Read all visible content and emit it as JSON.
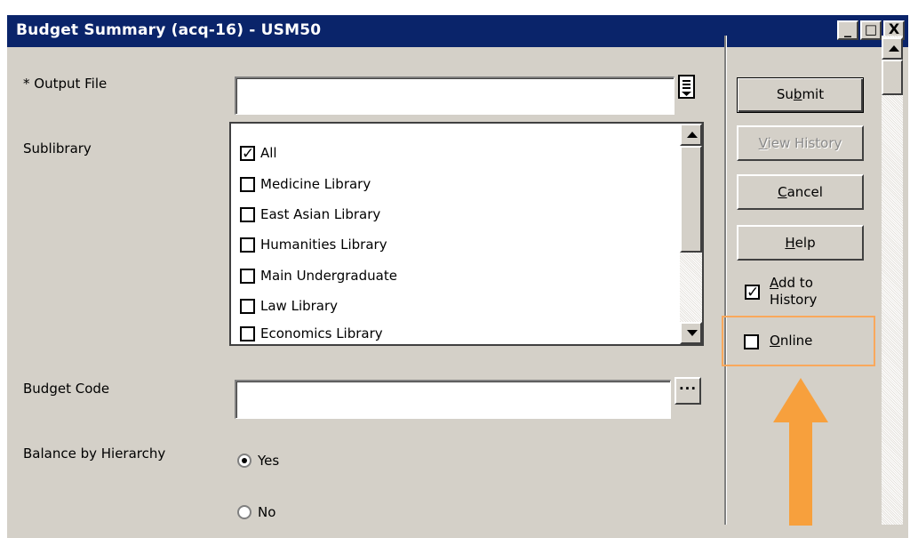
{
  "window": {
    "title": "Budget Summary (acq-16) - USM50",
    "controls": {
      "minimize": "_",
      "maximize": "□",
      "close": "X"
    }
  },
  "form": {
    "output_file": {
      "label": "* Output File",
      "value": ""
    },
    "sublibrary": {
      "label": "Sublibrary",
      "items": [
        {
          "label": "All",
          "checked": true
        },
        {
          "label": "Medicine Library",
          "checked": false
        },
        {
          "label": "East Asian Library",
          "checked": false
        },
        {
          "label": "Humanities Library",
          "checked": false
        },
        {
          "label": "Main Undergraduate",
          "checked": false
        },
        {
          "label": "Law Library",
          "checked": false
        },
        {
          "label": "Economics Library",
          "checked": false
        }
      ]
    },
    "budget_code": {
      "label": "Budget Code",
      "value": ""
    },
    "balance_by_hierarchy": {
      "label": "Balance by Hierarchy",
      "options": [
        {
          "label": "Yes",
          "selected": true
        },
        {
          "label": "No",
          "selected": false
        }
      ]
    }
  },
  "actions": {
    "submit": {
      "pre": "Su",
      "accel": "b",
      "post": "mit"
    },
    "view_history": {
      "pre": "",
      "accel": "V",
      "post": "iew History"
    },
    "cancel": {
      "pre": "",
      "accel": "C",
      "post": "ancel"
    },
    "help": {
      "pre": "",
      "accel": "H",
      "post": "elp"
    },
    "add_to_history": {
      "line1_accel": "A",
      "line1_post": "dd to",
      "line2": "History",
      "checked": true
    },
    "online": {
      "accel": "O",
      "post": "nline",
      "checked": false
    }
  },
  "colors": {
    "title_bar": "#0a246a",
    "face": "#d4d0c8",
    "highlight": "#f9a85c",
    "arrow": "#f7a03d"
  }
}
